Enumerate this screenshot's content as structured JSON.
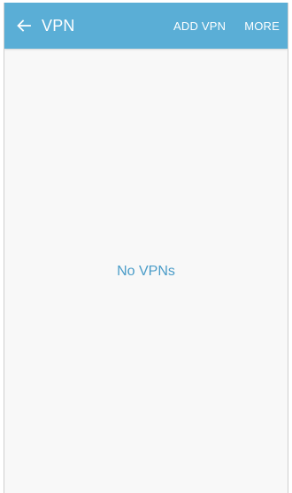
{
  "app_bar": {
    "title": "VPN",
    "back_icon": "arrow-left-icon",
    "actions": {
      "add_vpn": "ADD VPN",
      "more": "MORE"
    },
    "background_color": "#5aaed6",
    "text_color": "#ffffff"
  },
  "content": {
    "empty_message": "No VPNs",
    "empty_message_color": "#4a9cc8"
  }
}
